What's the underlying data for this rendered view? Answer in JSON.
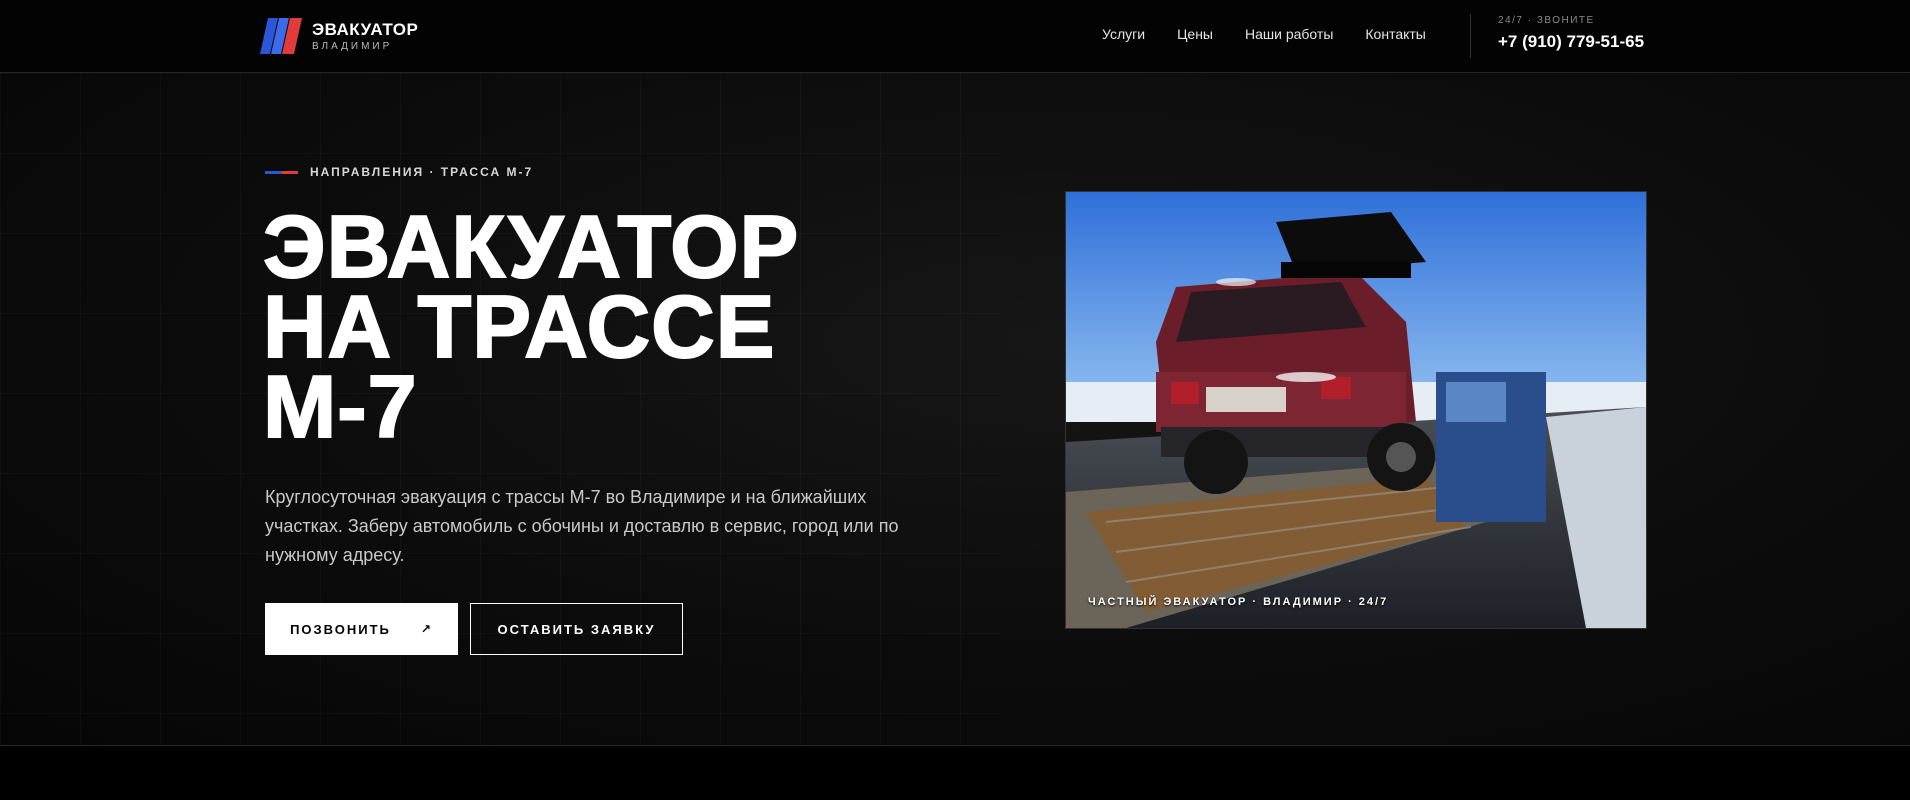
{
  "header": {
    "logo": {
      "title": "ЭВАКУАТОР",
      "subtitle": "ВЛАДИМИР"
    },
    "nav": [
      "Услуги",
      "Цены",
      "Наши работы",
      "Контакты"
    ],
    "phone": {
      "caption": "24/7 · ЗВОНИТЕ",
      "number": "+7 (910) 779-51-65"
    }
  },
  "hero": {
    "eyebrow": "НАПРАВЛЕНИЯ · ТРАССА М-7",
    "headline": [
      "ЭВАКУАТОР",
      "НА ТРАССЕ",
      "М-7"
    ],
    "lead": "Круглосуточная эвакуация с трассы М-7 во Владимире и на ближайших участках. Заберу автомобиль с обочины и доставлю в сервис, город или по нужному адресу.",
    "buttons": {
      "call": "ПОЗВОНИТЬ",
      "call_icon": "↗",
      "request": "ОСТАВИТЬ ЗАЯВКУ"
    },
    "photo_caption": "ЧАСТНЫЙ ЭВАКУАТОР · ВЛАДИМИР · 24/7"
  },
  "colors": {
    "brand_blue": "#2b56d6",
    "brand_red": "#e23b3b",
    "background": "#000000"
  },
  "icons": {
    "logo": "flag-stripes-icon",
    "call_arrow": "arrow-up-right-icon"
  }
}
